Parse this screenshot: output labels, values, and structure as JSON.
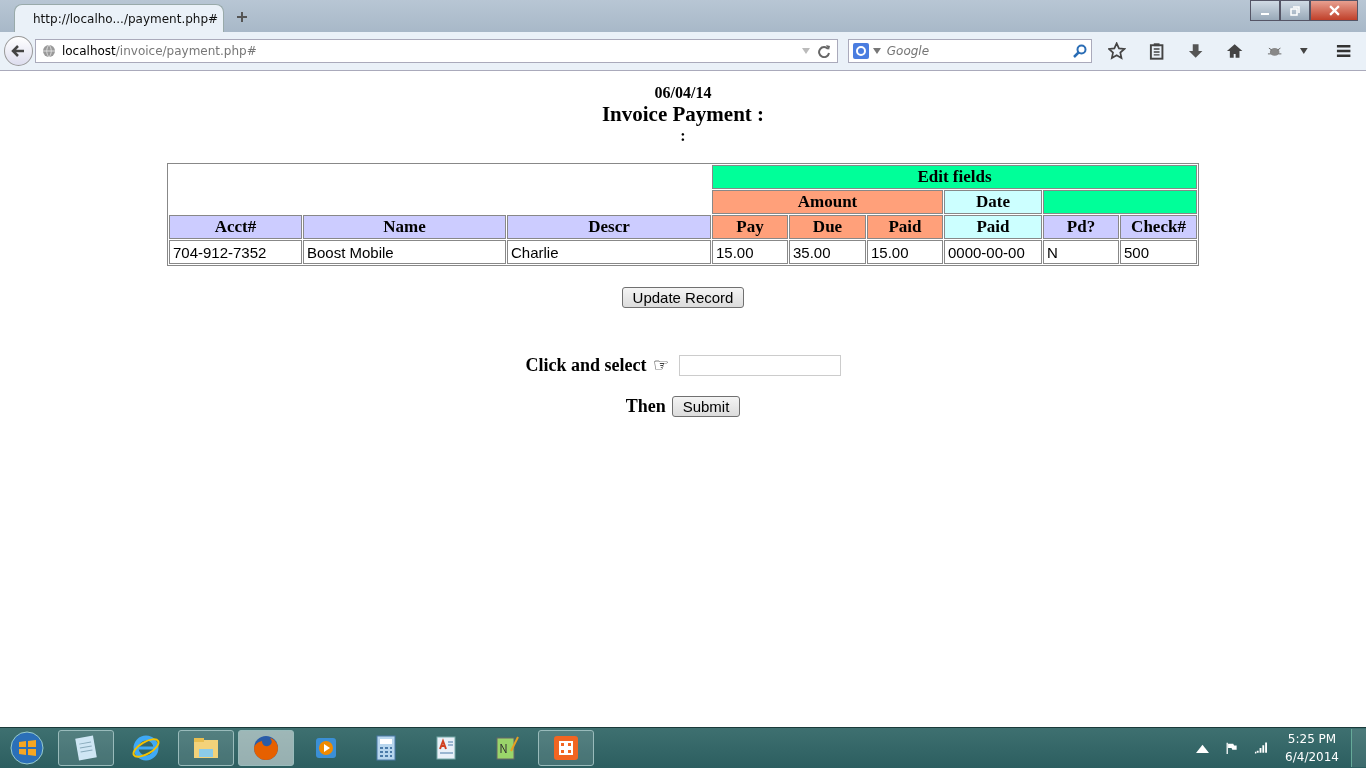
{
  "browser": {
    "tab": {
      "title": "http://localho.../payment.php#",
      "selected": true
    },
    "url": {
      "host": "localhost",
      "path": "/invoice/payment.php#"
    },
    "search": {
      "placeholder": "Google"
    }
  },
  "page": {
    "date": "06/04/14",
    "title": "Invoice Payment :",
    "subtitle": ":",
    "table": {
      "group_header": "Edit fields",
      "subgroups": [
        {
          "label": "Amount",
          "kind": "amount"
        },
        {
          "label": "Date",
          "kind": "date"
        }
      ],
      "columns": [
        {
          "label": "Acct#",
          "kind": "plain"
        },
        {
          "label": "Name",
          "kind": "plain"
        },
        {
          "label": "Descr",
          "kind": "plain"
        },
        {
          "label": "Pay",
          "kind": "amount"
        },
        {
          "label": "Due",
          "kind": "amount"
        },
        {
          "label": "Paid",
          "kind": "amount"
        },
        {
          "label": "Paid",
          "kind": "date"
        },
        {
          "label": "Pd?",
          "kind": "plain"
        },
        {
          "label": "Check#",
          "kind": "plain"
        }
      ],
      "rows": [
        [
          "704-912-7352",
          "Boost Mobile",
          "Charlie",
          "15.00",
          "35.00",
          "15.00",
          "0000-00-00",
          "N",
          "500"
        ]
      ]
    },
    "update_button": "Update Record",
    "select_label": "Click and select",
    "pointer": "☞",
    "then_label": "Then",
    "submit_button": "Submit"
  },
  "taskbar": {
    "apps": [
      {
        "kind": "notepad",
        "running": true,
        "selected": false
      },
      {
        "kind": "ie",
        "running": false,
        "selected": false
      },
      {
        "kind": "explorer",
        "running": true,
        "selected": false
      },
      {
        "kind": "firefox",
        "running": true,
        "selected": true
      },
      {
        "kind": "media",
        "running": false,
        "selected": false
      },
      {
        "kind": "calculator",
        "running": false,
        "selected": false
      },
      {
        "kind": "wordpad",
        "running": false,
        "selected": false
      },
      {
        "kind": "notepadpp",
        "running": false,
        "selected": false
      },
      {
        "kind": "xampp",
        "running": true,
        "selected": false
      }
    ],
    "time": "5:25 PM",
    "date": "6/4/2014"
  }
}
